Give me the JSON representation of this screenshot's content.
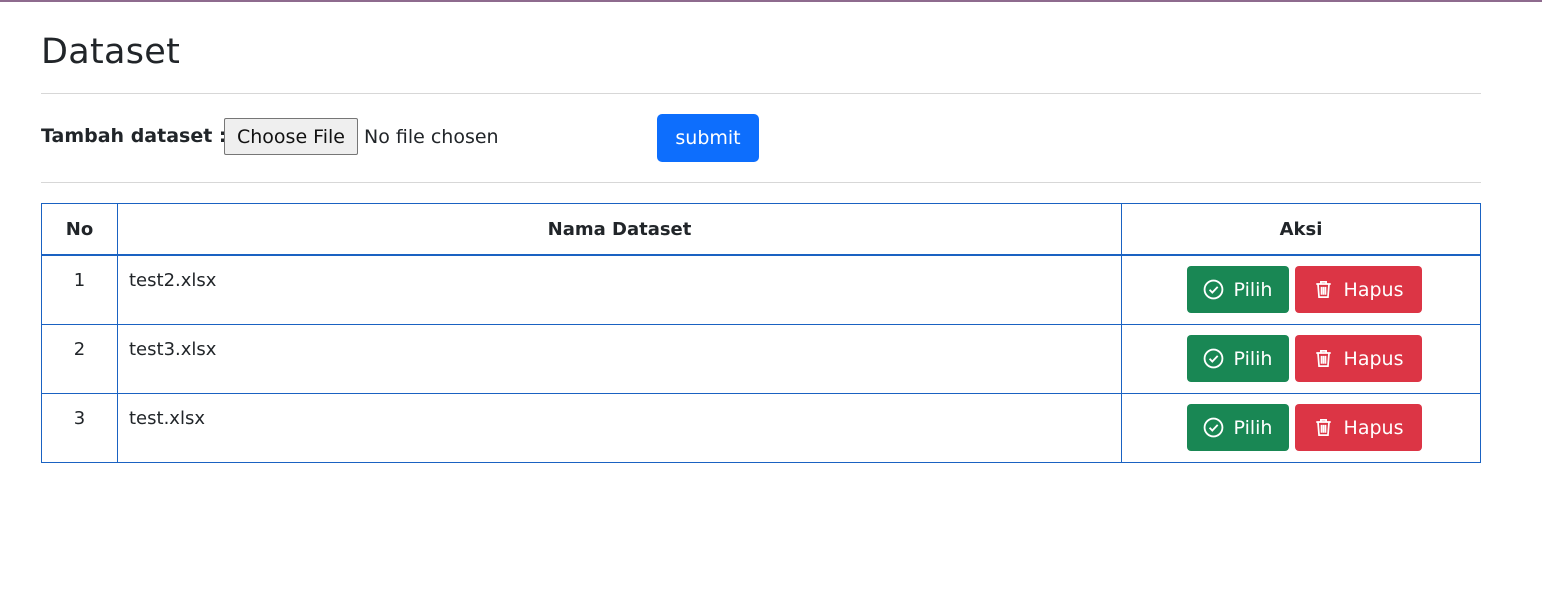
{
  "page": {
    "title": "Dataset"
  },
  "upload": {
    "label": "Tambah dataset :",
    "choose_label": "Choose File",
    "status": "No file chosen",
    "submit_label": "submit"
  },
  "table": {
    "headers": {
      "no": "No",
      "name": "Nama Dataset",
      "actions": "Aksi"
    },
    "rows": [
      {
        "no": "1",
        "name": "test2.xlsx",
        "pilih": "Pilih",
        "hapus": "Hapus"
      },
      {
        "no": "2",
        "name": "test3.xlsx",
        "pilih": "Pilih",
        "hapus": "Hapus"
      },
      {
        "no": "3",
        "name": "test.xlsx",
        "pilih": "Pilih",
        "hapus": "Hapus"
      }
    ]
  },
  "icons": {
    "pilih": "check-circle-icon",
    "hapus": "trash-icon"
  },
  "colors": {
    "primary": "#0d6efd",
    "success": "#198754",
    "danger": "#dc3545",
    "table_border": "#1a62c2"
  }
}
